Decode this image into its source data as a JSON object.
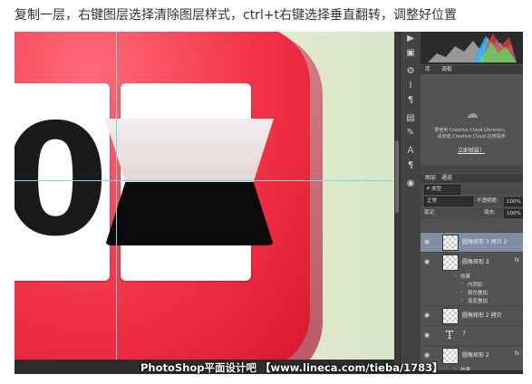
{
  "caption": "复制一层，右键图层选择清除图层样式，ctrl+t右键选择垂直翻转，调整好位置",
  "canvas": {
    "digit": "0"
  },
  "side_icons": [
    "▶",
    "▣",
    "⚙",
    "Ⅰ",
    "¶",
    "▤",
    "✎",
    "Ａ",
    "¶",
    "◉"
  ],
  "panels": {
    "tabs": [
      "库",
      "调板"
    ],
    "cc_text_line1": "要使用 Creative Cloud Libraries，",
    "cc_text_line2": "请安装 Creative Cloud 应用程序",
    "cc_link": "立即就装！",
    "layers_tabs": [
      "图层",
      "通道"
    ],
    "filter_label": "P 类型",
    "blend_mode": "正常",
    "opacity_label": "不透明度:",
    "opacity_value": "100%",
    "lock_label": "锁定:",
    "fill_label": "填充:",
    "fill_value": "100%",
    "layers": [
      {
        "name": "圆角矩形 3 拷贝 2",
        "selected": true,
        "fx": ""
      },
      {
        "name": "圆角矩形 3",
        "selected": false,
        "fx": "fx"
      },
      {
        "name": "圆角矩形 2 拷贝",
        "selected": false,
        "fx": ""
      },
      {
        "name": "7",
        "selected": false,
        "fx": "",
        "type": "text"
      },
      {
        "name": "圆角矩形 2",
        "selected": false,
        "fx": "fx"
      }
    ],
    "effects_label": "效果",
    "effects": [
      "内阴影",
      "颜色叠加",
      "渐变叠加"
    ],
    "last_effect_label": "效果"
  },
  "watermark": "PhotoShop平面设计吧 【www.lineca.com/tieba/1783】"
}
